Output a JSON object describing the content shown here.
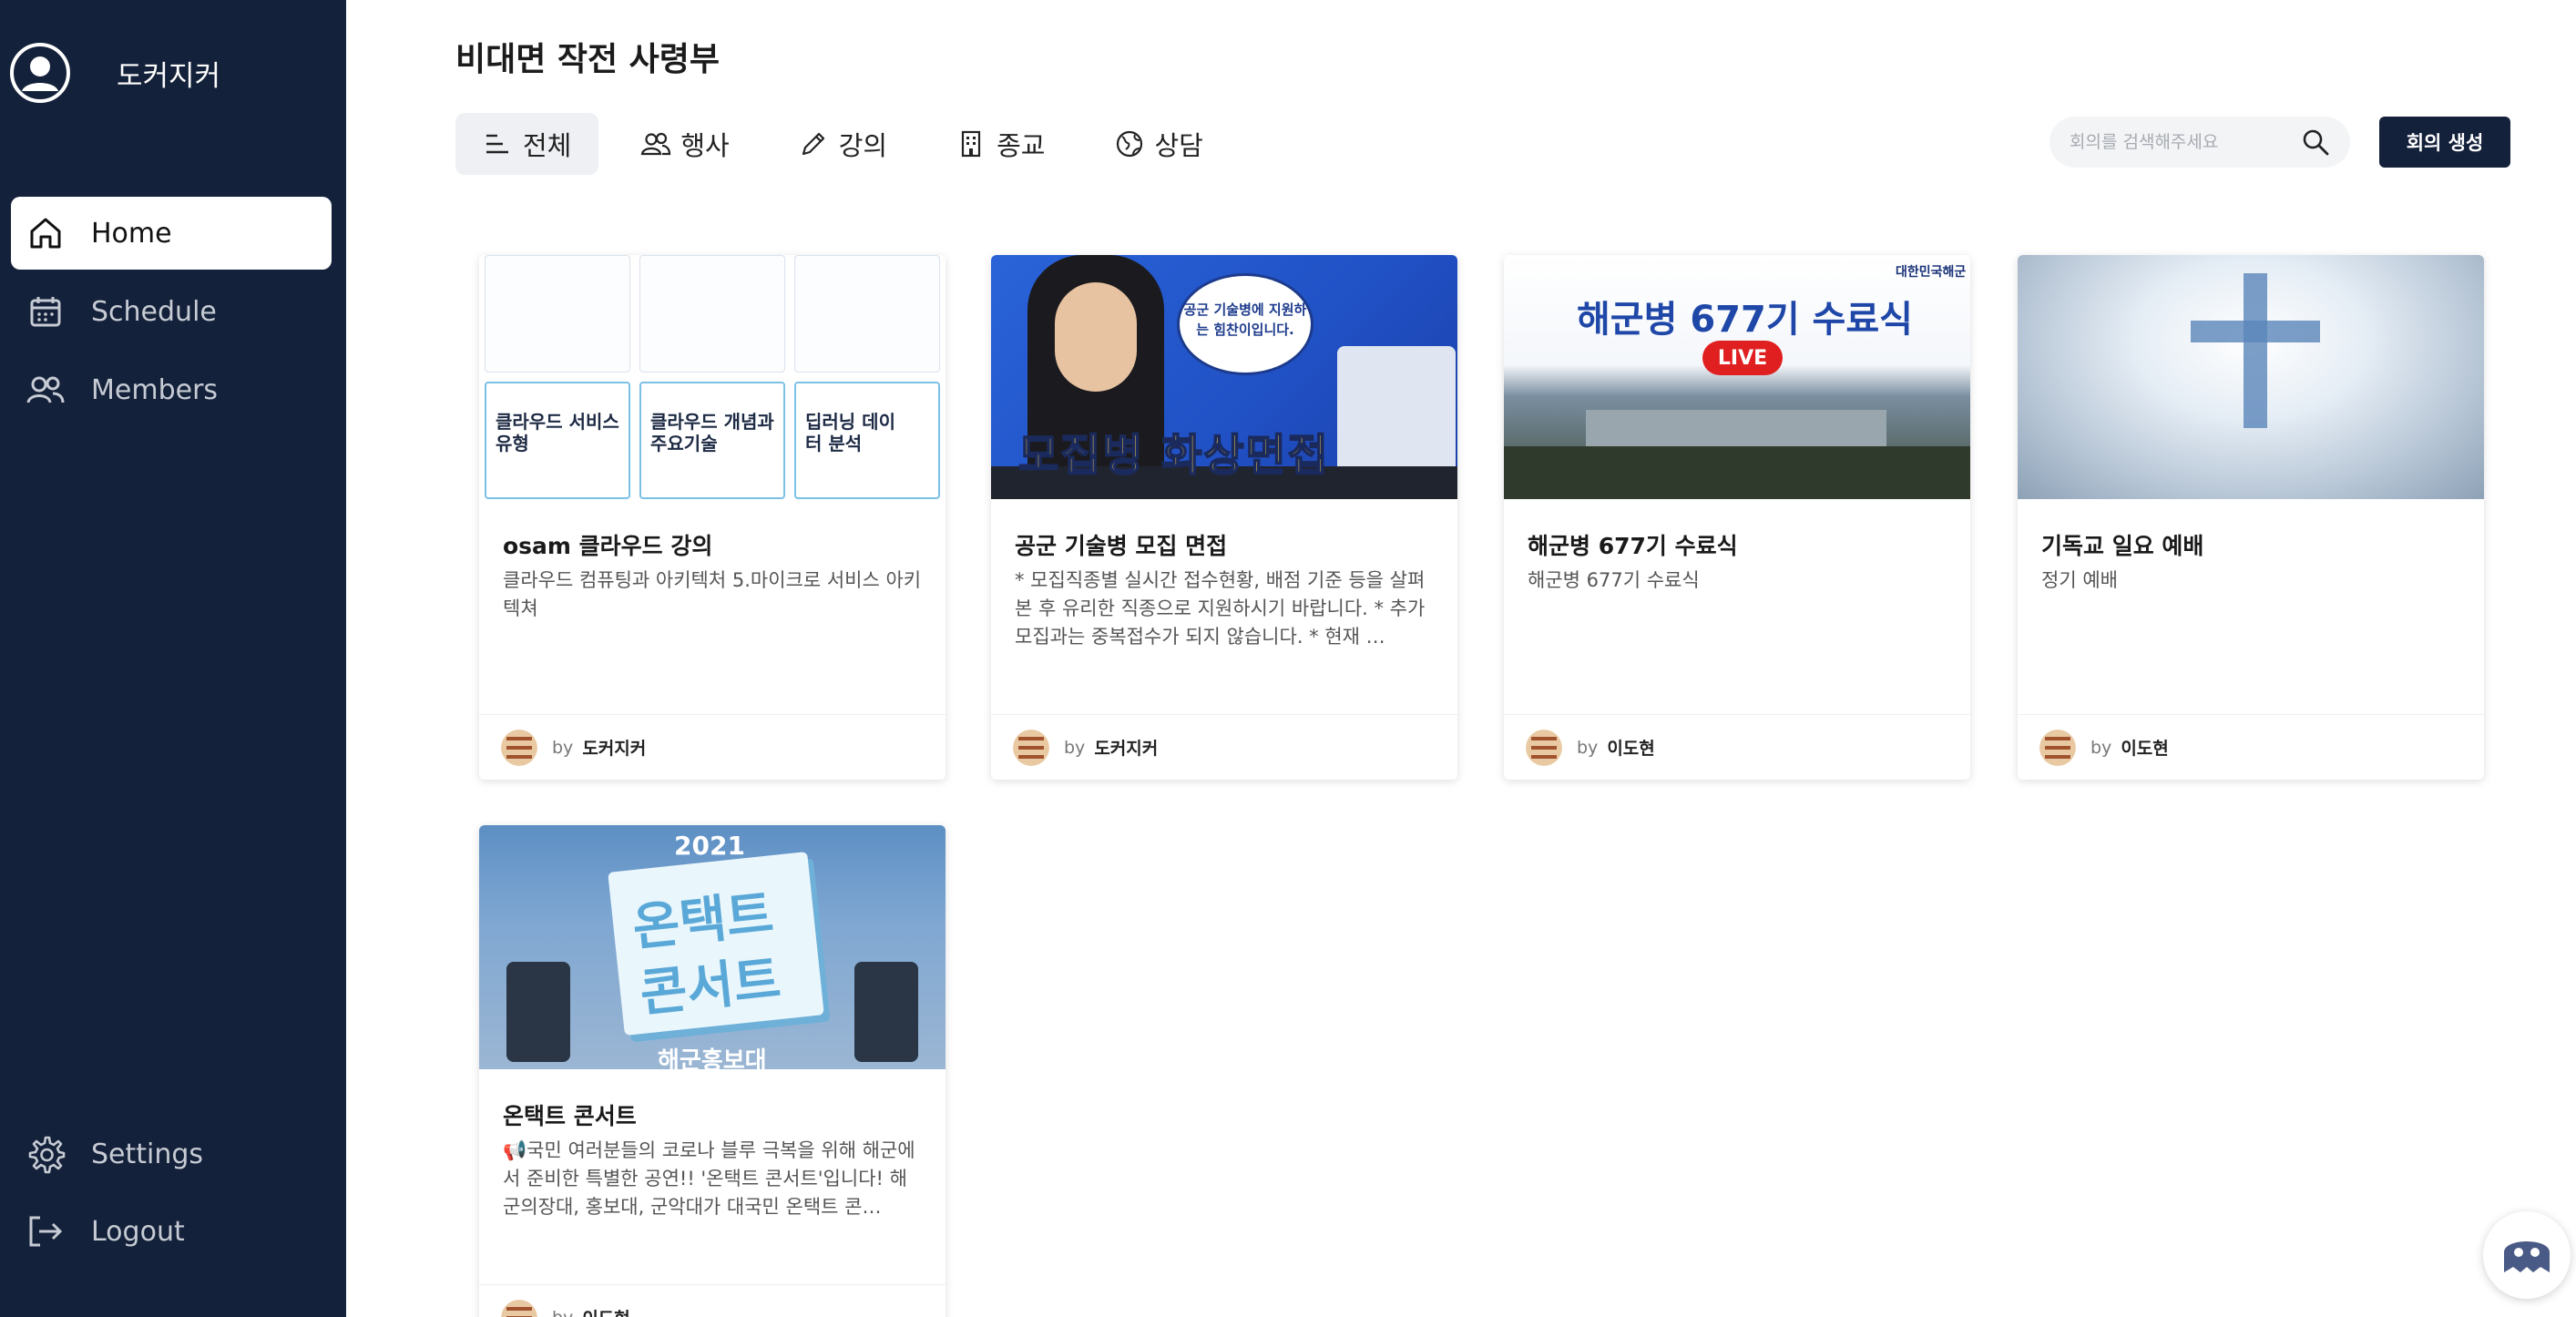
{
  "app": {
    "user_name": "도커지커",
    "page_title": "비대면 작전 사령부"
  },
  "sidebar": {
    "items": [
      {
        "label": "Home",
        "icon": "home-icon",
        "active": true
      },
      {
        "label": "Schedule",
        "icon": "calendar-icon",
        "active": false
      },
      {
        "label": "Members",
        "icon": "users-icon",
        "active": false
      }
    ],
    "bottom_items": [
      {
        "label": "Settings",
        "icon": "gear-icon"
      },
      {
        "label": "Logout",
        "icon": "logout-icon"
      }
    ]
  },
  "tabs": [
    {
      "label": "전체",
      "icon": "list-icon",
      "active": true
    },
    {
      "label": "행사",
      "icon": "people-icon",
      "active": false
    },
    {
      "label": "강의",
      "icon": "pencil-icon",
      "active": false
    },
    {
      "label": "종교",
      "icon": "building-icon",
      "active": false
    },
    {
      "label": "상담",
      "icon": "globe-icon",
      "active": false
    }
  ],
  "search": {
    "placeholder": "회의를 검색해주세요",
    "value": ""
  },
  "create_button_label": "회의 생성",
  "by_label": "by",
  "cards": [
    {
      "title": "osam 클라우드 강의",
      "description": "클라우드 컴퓨팅과 아키텍처 5.마이크로 서비스 아키텍쳐",
      "author": "도커지커",
      "thumb_text": [
        "클라우드 서비스 유형",
        "클라우드 개념과 주요기술",
        "딥러닝 데이터 분석"
      ]
    },
    {
      "title": "공군 기술병 모집 면접",
      "description": "* 모집직종별 실시간 접수현황, 배점 기준 등을 살펴본 후 유리한 직종으로 지원하시기 바랍니다. * 추가모집과는 중복접수가 되지 않습니다. * 현재 …",
      "author": "도커지커",
      "thumb_text": [
        "모집병 화상면접",
        "공군 기술병에 지원하는 힘찬이입니다."
      ]
    },
    {
      "title": "해군병 677기 수료식",
      "description": "해군병 677기 수료식",
      "author": "이도현",
      "thumb_text": [
        "해군병 677기 수료식",
        "LIVE",
        "대한민국해군"
      ]
    },
    {
      "title": "기독교 일요 예배",
      "description": "정기 예배",
      "author": "이도현"
    },
    {
      "title": "온택트 콘서트",
      "description": "📢국민 여러분들의 코로나 블루 극복을 위해 해군에서 준비한 특별한 공연!! '온택트 콘서트'입니다! 해군의장대, 홍보대, 군악대가 대국민 온택트 콘…",
      "author": "이도현",
      "thumb_text": [
        "2021",
        "온택트",
        "콘서트",
        "해군홍보대"
      ]
    }
  ],
  "colors": {
    "sidebar_bg": "#14213a",
    "accent": "#14213a",
    "live_red": "#e02020"
  }
}
